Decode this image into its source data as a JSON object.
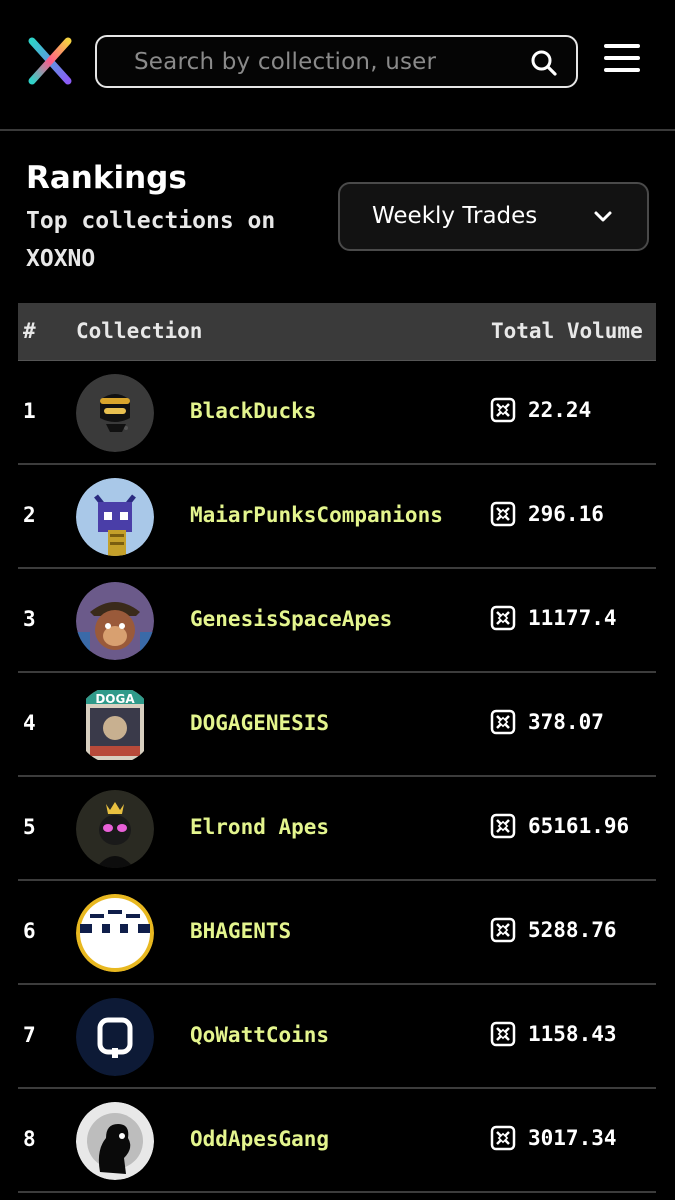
{
  "header": {
    "logo_icon": "xoxno-x-logo-icon",
    "search_placeholder": "Search by collection, user",
    "search_icon": "search-icon",
    "menu_icon": "hamburger-menu-icon"
  },
  "rankings": {
    "title": "Rankings",
    "subtitle": "Top collections on XOXNO",
    "filter_selected": "Weekly Trades"
  },
  "table": {
    "headers": {
      "rank": "#",
      "collection": "Collection",
      "volume": "Total Volume"
    },
    "currency_icon": "egld-icon",
    "rows": [
      {
        "rank": "1",
        "name": "BlackDucks",
        "volume": "22.24",
        "avatar_color": "#3a3a3a"
      },
      {
        "rank": "2",
        "name": "MaiarPunksCompanions",
        "volume": "296.16",
        "avatar_color": "#a9c8e8"
      },
      {
        "rank": "3",
        "name": "GenesisSpaceApes",
        "volume": "11177.4",
        "avatar_color": "#6b5a8a"
      },
      {
        "rank": "4",
        "name": "DOGAGENESIS",
        "volume": "378.07",
        "avatar_color": "#d8cfc0"
      },
      {
        "rank": "5",
        "name": "Elrond Apes",
        "volume": "65161.96",
        "avatar_color": "#2a2a22"
      },
      {
        "rank": "6",
        "name": "BHAGENTS",
        "volume": "5288.76",
        "avatar_color": "#0f1e4a"
      },
      {
        "rank": "7",
        "name": "QoWattCoins",
        "volume": "1158.43",
        "avatar_color": "#0d1a36"
      },
      {
        "rank": "8",
        "name": "OddApesGang",
        "volume": "3017.34",
        "avatar_color": "#e8e8e8"
      }
    ]
  }
}
